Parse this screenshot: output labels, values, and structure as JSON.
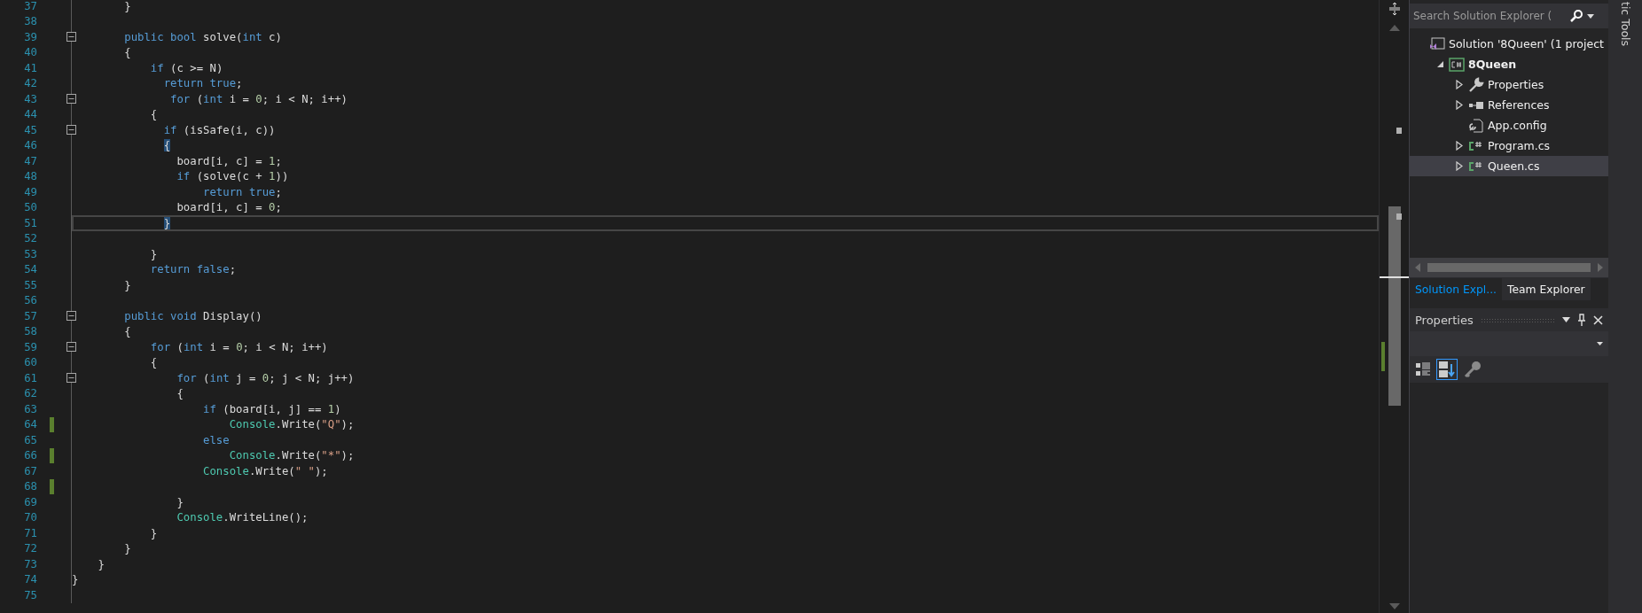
{
  "editor": {
    "lines": [
      {
        "number": "37",
        "changed": false,
        "collapsible": false,
        "current": false,
        "tokens": [
          {
            "kind": "plain",
            "text": "        }"
          }
        ]
      },
      {
        "number": "38",
        "changed": false,
        "collapsible": false,
        "current": false
      },
      {
        "number": "39",
        "changed": false,
        "collapsible": true,
        "current": false,
        "tokens": [
          {
            "kind": "keyword",
            "text": "        public bool "
          },
          {
            "kind": "plain",
            "text": "solve("
          },
          {
            "kind": "keyword",
            "text": "int"
          },
          {
            "kind": "plain",
            "text": " c)"
          }
        ]
      },
      {
        "number": "40",
        "changed": false,
        "collapsible": false,
        "current": false,
        "tokens": [
          {
            "kind": "plain",
            "text": "        {"
          }
        ]
      },
      {
        "number": "41",
        "changed": false,
        "collapsible": false,
        "current": false,
        "tokens": [
          {
            "kind": "keyword",
            "text": "            if"
          },
          {
            "kind": "plain",
            "text": " (c >= N)"
          }
        ]
      },
      {
        "number": "42",
        "changed": false,
        "collapsible": false,
        "current": false,
        "tokens": [
          {
            "kind": "keyword",
            "text": "              return true"
          },
          {
            "kind": "plain",
            "text": ";"
          }
        ]
      },
      {
        "number": "43",
        "changed": false,
        "collapsible": true,
        "current": false,
        "tokens": [
          {
            "kind": "keyword",
            "text": "               for"
          },
          {
            "kind": "plain",
            "text": " ("
          },
          {
            "kind": "keyword",
            "text": "int"
          },
          {
            "kind": "plain",
            "text": " i = "
          },
          {
            "kind": "number",
            "text": "0"
          },
          {
            "kind": "plain",
            "text": "; i < N; i++)"
          }
        ]
      },
      {
        "number": "44",
        "changed": false,
        "collapsible": false,
        "current": false,
        "tokens": [
          {
            "kind": "plain",
            "text": "            {"
          }
        ]
      },
      {
        "number": "45",
        "changed": false,
        "collapsible": true,
        "current": false,
        "tokens": [
          {
            "kind": "keyword",
            "text": "              if"
          },
          {
            "kind": "plain",
            "text": " (isSafe(i, c))"
          }
        ]
      },
      {
        "number": "46",
        "changed": false,
        "collapsible": false,
        "current": false,
        "tokens": [
          {
            "kind": "brace-match",
            "text": "              {"
          }
        ]
      },
      {
        "number": "47",
        "changed": false,
        "collapsible": false,
        "current": false,
        "tokens": [
          {
            "kind": "plain",
            "text": "                board[i, c] = "
          },
          {
            "kind": "number",
            "text": "1"
          },
          {
            "kind": "plain",
            "text": ";"
          }
        ]
      },
      {
        "number": "48",
        "changed": false,
        "collapsible": false,
        "current": false,
        "tokens": [
          {
            "kind": "keyword",
            "text": "                if"
          },
          {
            "kind": "plain",
            "text": " (solve(c + "
          },
          {
            "kind": "number",
            "text": "1"
          },
          {
            "kind": "plain",
            "text": "))"
          }
        ]
      },
      {
        "number": "49",
        "changed": false,
        "collapsible": false,
        "current": false,
        "tokens": [
          {
            "kind": "keyword",
            "text": "                    return true"
          },
          {
            "kind": "plain",
            "text": ";"
          }
        ]
      },
      {
        "number": "50",
        "changed": false,
        "collapsible": false,
        "current": false,
        "tokens": [
          {
            "kind": "plain",
            "text": "                board[i, c] = "
          },
          {
            "kind": "number",
            "text": "0"
          },
          {
            "kind": "plain",
            "text": ";"
          }
        ]
      },
      {
        "number": "51",
        "changed": false,
        "collapsible": false,
        "current": true,
        "tokens": [
          {
            "kind": "brace-match",
            "text": "              }"
          }
        ]
      },
      {
        "number": "52",
        "changed": false,
        "collapsible": false,
        "current": false
      },
      {
        "number": "53",
        "changed": false,
        "collapsible": false,
        "current": false,
        "tokens": [
          {
            "kind": "plain",
            "text": "            }"
          }
        ]
      },
      {
        "number": "54",
        "changed": false,
        "collapsible": false,
        "current": false,
        "tokens": [
          {
            "kind": "keyword",
            "text": "            return false"
          },
          {
            "kind": "plain",
            "text": ";"
          }
        ]
      },
      {
        "number": "55",
        "changed": false,
        "collapsible": false,
        "current": false,
        "tokens": [
          {
            "kind": "plain",
            "text": "        }"
          }
        ]
      },
      {
        "number": "56",
        "changed": false,
        "collapsible": false,
        "current": false
      },
      {
        "number": "57",
        "changed": false,
        "collapsible": true,
        "current": false,
        "tokens": [
          {
            "kind": "keyword",
            "text": "        public void "
          },
          {
            "kind": "plain",
            "text": "Display()"
          }
        ]
      },
      {
        "number": "58",
        "changed": false,
        "collapsible": false,
        "current": false,
        "tokens": [
          {
            "kind": "plain",
            "text": "        {"
          }
        ]
      },
      {
        "number": "59",
        "changed": false,
        "collapsible": true,
        "current": false,
        "tokens": [
          {
            "kind": "keyword",
            "text": "            for"
          },
          {
            "kind": "plain",
            "text": " ("
          },
          {
            "kind": "keyword",
            "text": "int"
          },
          {
            "kind": "plain",
            "text": " i = "
          },
          {
            "kind": "number",
            "text": "0"
          },
          {
            "kind": "plain",
            "text": "; i < N; i++)"
          }
        ]
      },
      {
        "number": "60",
        "changed": false,
        "collapsible": false,
        "current": false,
        "tokens": [
          {
            "kind": "plain",
            "text": "            {"
          }
        ]
      },
      {
        "number": "61",
        "changed": false,
        "collapsible": true,
        "current": false,
        "tokens": [
          {
            "kind": "keyword",
            "text": "                for"
          },
          {
            "kind": "plain",
            "text": " ("
          },
          {
            "kind": "keyword",
            "text": "int"
          },
          {
            "kind": "plain",
            "text": " j = "
          },
          {
            "kind": "number",
            "text": "0"
          },
          {
            "kind": "plain",
            "text": "; j < N; j++)"
          }
        ]
      },
      {
        "number": "62",
        "changed": false,
        "collapsible": false,
        "current": false,
        "tokens": [
          {
            "kind": "plain",
            "text": "                {"
          }
        ]
      },
      {
        "number": "63",
        "changed": false,
        "collapsible": false,
        "current": false,
        "tokens": [
          {
            "kind": "keyword",
            "text": "                    if"
          },
          {
            "kind": "plain",
            "text": " (board[i, j] == "
          },
          {
            "kind": "number",
            "text": "1"
          },
          {
            "kind": "plain",
            "text": ")"
          }
        ]
      },
      {
        "number": "64",
        "changed": true,
        "collapsible": false,
        "current": false,
        "tokens": [
          {
            "kind": "type",
            "text": "                        Console"
          },
          {
            "kind": "plain",
            "text": ".Write("
          },
          {
            "kind": "string",
            "text": "\"Q\""
          },
          {
            "kind": "plain",
            "text": ");"
          }
        ]
      },
      {
        "number": "65",
        "changed": false,
        "collapsible": false,
        "current": false,
        "tokens": [
          {
            "kind": "keyword",
            "text": "                    else"
          }
        ]
      },
      {
        "number": "66",
        "changed": true,
        "collapsible": false,
        "current": false,
        "tokens": [
          {
            "kind": "type",
            "text": "                        Console"
          },
          {
            "kind": "plain",
            "text": ".Write("
          },
          {
            "kind": "string",
            "text": "\"*\""
          },
          {
            "kind": "plain",
            "text": ");"
          }
        ]
      },
      {
        "number": "67",
        "changed": false,
        "collapsible": false,
        "current": false,
        "tokens": [
          {
            "kind": "type",
            "text": "                    Console"
          },
          {
            "kind": "plain",
            "text": ".Write("
          },
          {
            "kind": "string",
            "text": "\" \""
          },
          {
            "kind": "plain",
            "text": ");"
          }
        ]
      },
      {
        "number": "68",
        "changed": true,
        "collapsible": false,
        "current": false
      },
      {
        "number": "69",
        "changed": false,
        "collapsible": false,
        "current": false,
        "tokens": [
          {
            "kind": "plain",
            "text": "                }"
          }
        ]
      },
      {
        "number": "70",
        "changed": false,
        "collapsible": false,
        "current": false,
        "tokens": [
          {
            "kind": "type",
            "text": "                Console"
          },
          {
            "kind": "plain",
            "text": ".WriteLine();"
          }
        ]
      },
      {
        "number": "71",
        "changed": false,
        "collapsible": false,
        "current": false,
        "tokens": [
          {
            "kind": "plain",
            "text": "            }"
          }
        ]
      },
      {
        "number": "72",
        "changed": false,
        "collapsible": false,
        "current": false,
        "tokens": [
          {
            "kind": "plain",
            "text": "        }"
          }
        ]
      },
      {
        "number": "73",
        "changed": false,
        "collapsible": false,
        "current": false,
        "tokens": [
          {
            "kind": "plain",
            "text": "    }"
          }
        ]
      },
      {
        "number": "74",
        "changed": false,
        "collapsible": false,
        "current": false,
        "tokens": [
          {
            "kind": "plain",
            "text": "}"
          }
        ]
      },
      {
        "number": "75",
        "changed": false,
        "collapsible": false,
        "current": false
      }
    ]
  },
  "solution_explorer": {
    "search": {
      "placeholder": "Search Solution Explorer ("
    },
    "tree": [
      {
        "label": "Solution '8Queen' (1 project",
        "kind": "solution",
        "bold": false,
        "selected": false,
        "children": [
          {
            "label": "8Queen",
            "kind": "project",
            "expanded": true,
            "bold": true,
            "selected": false,
            "children": [
              {
                "label": "Properties",
                "kind": "properties",
                "expanded": false,
                "bold": false,
                "selected": false
              },
              {
                "label": "References",
                "kind": "references",
                "expanded": false,
                "bold": false,
                "selected": false
              },
              {
                "label": "App.config",
                "kind": "config",
                "bold": false,
                "selected": false
              },
              {
                "label": "Program.cs",
                "kind": "code-file",
                "expanded": false,
                "bold": false,
                "selected": false
              },
              {
                "label": "Queen.cs",
                "kind": "code-file",
                "expanded": false,
                "bold": false,
                "selected": true
              }
            ]
          }
        ]
      }
    ]
  },
  "tabs": [
    {
      "label": "Solution Expl...",
      "selected": true
    },
    {
      "label": "Team Explorer",
      "selected": false
    }
  ],
  "properties": {
    "title": "Properties"
  },
  "side_tab": {
    "label": "tic Tools"
  }
}
